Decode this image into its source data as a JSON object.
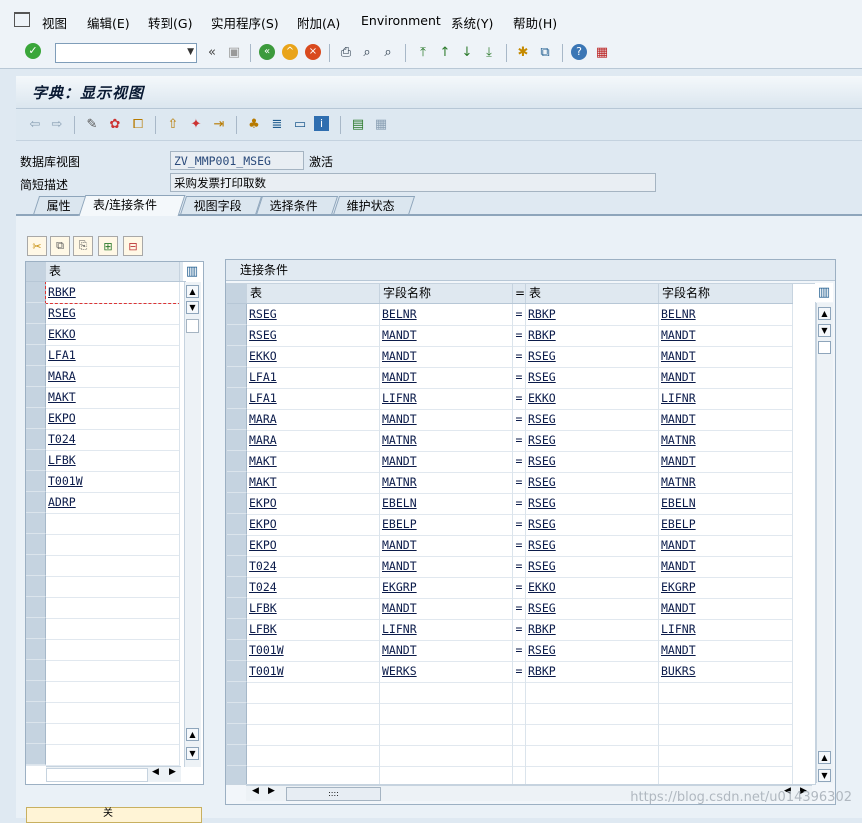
{
  "menu": [
    "视图",
    "编辑(E)",
    "转到(G)",
    "实用程序(S)",
    "附加(A)",
    "Environment",
    "系统(Y)",
    "帮助(H)"
  ],
  "title": "字典：显示视图",
  "fields": {
    "db_view_label": "数据库视图",
    "db_view_value": "ZV_MMP001_MSEG",
    "status": "激活",
    "short_desc_label": "简短描述",
    "short_desc_value": "采购发票打印取数"
  },
  "tabs": [
    "属性",
    "表/连接条件",
    "视图字段",
    "选择条件",
    "维护状态"
  ],
  "active_tab": "表/连接条件",
  "left_table": {
    "header": "表",
    "rows": [
      "RBKP",
      "RSEG",
      "EKKO",
      "LFA1",
      "MARA",
      "MAKT",
      "EKPO",
      "T024",
      "LFBK",
      "T001W",
      "ADRP"
    ]
  },
  "join_table": {
    "title": "连接条件",
    "headers": [
      "表",
      "字段名称",
      "=",
      "表",
      "字段名称"
    ],
    "rows": [
      [
        "RSEG",
        "BELNR",
        "=",
        "RBKP",
        "BELNR"
      ],
      [
        "RSEG",
        "MANDT",
        "=",
        "RBKP",
        "MANDT"
      ],
      [
        "EKKO",
        "MANDT",
        "=",
        "RSEG",
        "MANDT"
      ],
      [
        "LFA1",
        "MANDT",
        "=",
        "RSEG",
        "MANDT"
      ],
      [
        "LFA1",
        "LIFNR",
        "=",
        "EKKO",
        "LIFNR"
      ],
      [
        "MARA",
        "MANDT",
        "=",
        "RSEG",
        "MANDT"
      ],
      [
        "MARA",
        "MATNR",
        "=",
        "RSEG",
        "MATNR"
      ],
      [
        "MAKT",
        "MANDT",
        "=",
        "RSEG",
        "MANDT"
      ],
      [
        "MAKT",
        "MATNR",
        "=",
        "RSEG",
        "MATNR"
      ],
      [
        "EKPO",
        "EBELN",
        "=",
        "RSEG",
        "EBELN"
      ],
      [
        "EKPO",
        "EBELP",
        "=",
        "RSEG",
        "EBELP"
      ],
      [
        "EKPO",
        "MANDT",
        "=",
        "RSEG",
        "MANDT"
      ],
      [
        "T024",
        "MANDT",
        "=",
        "RSEG",
        "MANDT"
      ],
      [
        "T024",
        "EKGRP",
        "=",
        "EKKO",
        "EKGRP"
      ],
      [
        "LFBK",
        "MANDT",
        "=",
        "RSEG",
        "MANDT"
      ],
      [
        "LFBK",
        "LIFNR",
        "=",
        "RBKP",
        "LIFNR"
      ],
      [
        "T001W",
        "MANDT",
        "=",
        "RSEG",
        "MANDT"
      ],
      [
        "T001W",
        "WERKS",
        "=",
        "RBKP",
        "BUKRS"
      ]
    ]
  },
  "close_label": "关",
  "watermark": "https://blog.csdn.net/u014396302"
}
